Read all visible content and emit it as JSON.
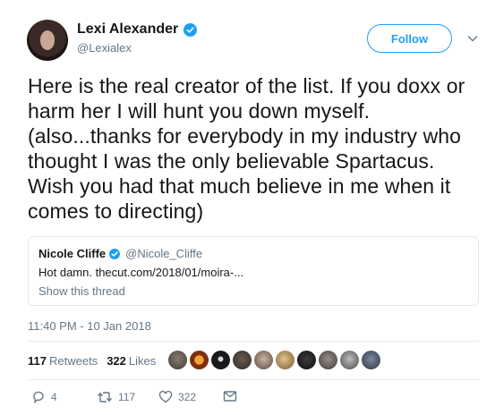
{
  "author": {
    "display_name": "Lexi Alexander",
    "handle": "@Lexialex",
    "verified_icon": "verified-badge-icon",
    "follow_label": "Follow"
  },
  "tweet": {
    "text": "Here is the real creator of the list. If you doxx or harm her I will hunt you down myself. (also...thanks for everybody in my industry who thought I was the only believable Spartacus. Wish you had that much believe in me when it comes to directing)",
    "timestamp": "11:40 PM - 10 Jan 2018"
  },
  "quoted_tweet": {
    "display_name": "Nicole Cliffe",
    "handle": "@Nicole_Cliffe",
    "body": "Hot damn. thecut.com/2018/01/moira-...",
    "show_thread": "Show this thread"
  },
  "stats": {
    "retweets_count": "117",
    "retweets_label": "Retweets",
    "likes_count": "322",
    "likes_label": "Likes"
  },
  "actions": {
    "reply_count": "4",
    "retweet_count": "117",
    "like_count": "322"
  },
  "colors": {
    "accent": "#1da1f2",
    "secondary_text": "#657786",
    "border": "#e1e8ed"
  }
}
